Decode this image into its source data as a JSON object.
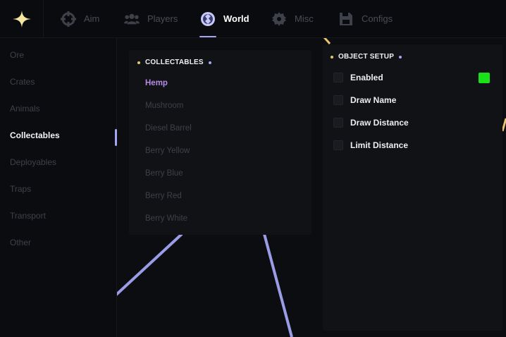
{
  "app": {
    "logo_icon": "sparkle-star-icon",
    "accent": "#a3a6f0",
    "logo_color": "#f5e6a1"
  },
  "topbar": {
    "tabs": [
      {
        "label": "Aim",
        "icon": "crosshair-icon"
      },
      {
        "label": "Players",
        "icon": "users-icon"
      },
      {
        "label": "World",
        "icon": "globe-icon",
        "active": true
      },
      {
        "label": "Misc",
        "icon": "gear-icon"
      },
      {
        "label": "Configs",
        "icon": "floppy-disk-icon"
      }
    ]
  },
  "sidebar": {
    "items": [
      {
        "label": "Ore"
      },
      {
        "label": "Crates"
      },
      {
        "label": "Animals"
      },
      {
        "label": "Collectables",
        "active": true
      },
      {
        "label": "Deployables"
      },
      {
        "label": "Traps"
      },
      {
        "label": "Transport"
      },
      {
        "label": "Other"
      }
    ]
  },
  "collectables": {
    "title": "COLLECTABLES",
    "items": [
      {
        "label": "Hemp",
        "selected": true
      },
      {
        "label": "Mushroom"
      },
      {
        "label": "Diesel Barrel"
      },
      {
        "label": "Berry Yellow"
      },
      {
        "label": "Berry Blue"
      },
      {
        "label": "Berry Red"
      },
      {
        "label": "Berry White"
      }
    ]
  },
  "object_setup": {
    "title": "OBJECT SETUP",
    "options": [
      {
        "label": "Enabled",
        "checked": false
      },
      {
        "label": "Draw Name",
        "checked": false
      },
      {
        "label": "Draw Distance",
        "checked": false
      },
      {
        "label": "Limit Distance",
        "checked": false
      }
    ],
    "enabled_color": "#19e219"
  }
}
